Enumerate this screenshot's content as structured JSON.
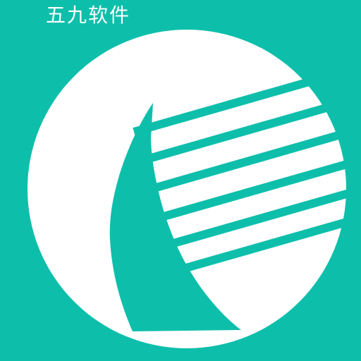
{
  "brand": {
    "text": "五九软件"
  },
  "icon": {
    "name": "bird-logo-icon",
    "stripe_count": 6
  },
  "colors": {
    "background": "#0dbfab",
    "foreground": "#ffffff"
  }
}
